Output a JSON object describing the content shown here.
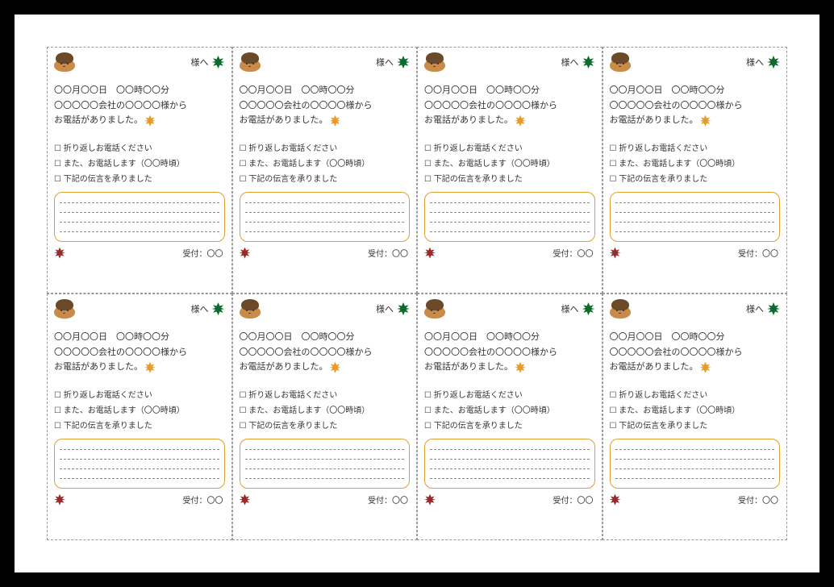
{
  "card": {
    "recipient_label": "様へ",
    "message_line1": "〇〇月〇〇日　〇〇時〇〇分",
    "message_line2": "〇〇〇〇〇会社の〇〇〇〇様から",
    "message_line3": "お電話がありました。",
    "checkbox1": "折り返しお電話ください",
    "checkbox2": "また、お電話します（〇〇時頃）",
    "checkbox3": "下記の伝言を承りました",
    "reception_label": "受付：〇〇"
  },
  "icons": {
    "chestnut": "chestnut-icon",
    "leaf_green": "maple-leaf-green-icon",
    "leaf_orange": "maple-leaf-orange-icon",
    "leaf_red": "maple-leaf-red-icon"
  }
}
